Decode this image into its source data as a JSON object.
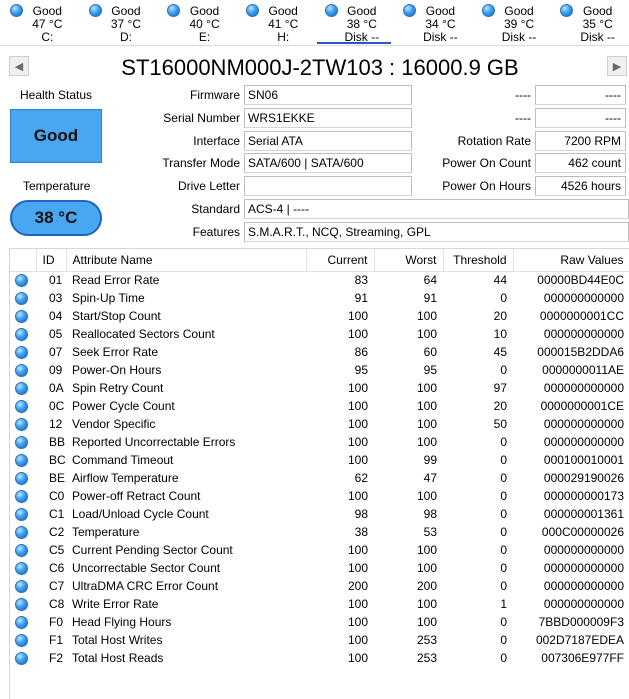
{
  "disks": [
    {
      "status": "Good",
      "temp": "47 °C",
      "label": "C:",
      "active": false
    },
    {
      "status": "Good",
      "temp": "37 °C",
      "label": "D:",
      "active": false
    },
    {
      "status": "Good",
      "temp": "40 °C",
      "label": "E:",
      "active": false
    },
    {
      "status": "Good",
      "temp": "41 °C",
      "label": "H:",
      "active": false
    },
    {
      "status": "Good",
      "temp": "38 °C",
      "label": "Disk --",
      "active": true
    },
    {
      "status": "Good",
      "temp": "34 °C",
      "label": "Disk --",
      "active": false
    },
    {
      "status": "Good",
      "temp": "39 °C",
      "label": "Disk --",
      "active": false
    },
    {
      "status": "Good",
      "temp": "35 °C",
      "label": "Disk --",
      "active": false
    }
  ],
  "nav": {
    "prev_icon": "◀",
    "next_icon": "▶"
  },
  "title": "ST16000NM000J-2TW103 : 16000.9 GB",
  "health": {
    "label": "Health Status",
    "value": "Good",
    "color": "#49a7f2"
  },
  "temperature": {
    "label": "Temperature",
    "value": "38 °C"
  },
  "fields": {
    "firmware": {
      "label": "Firmware",
      "value": "SN06"
    },
    "serial": {
      "label": "Serial Number",
      "value": "WRS1EKKE"
    },
    "interface": {
      "label": "Interface",
      "value": "Serial ATA"
    },
    "transfer_mode": {
      "label": "Transfer Mode",
      "value": "SATA/600 | SATA/600"
    },
    "drive_letter": {
      "label": "Drive Letter",
      "value": ""
    },
    "standard": {
      "label": "Standard",
      "value": "ACS-4 | ----"
    },
    "features": {
      "label": "Features",
      "value": "S.M.A.R.T., NCQ, Streaming, GPL"
    },
    "right1": {
      "label": "----",
      "value": "----"
    },
    "right2": {
      "label": "----",
      "value": "----"
    },
    "rotation_rate": {
      "label": "Rotation Rate",
      "value": "7200 RPM"
    },
    "power_on_count": {
      "label": "Power On Count",
      "value": "462 count"
    },
    "power_on_hours": {
      "label": "Power On Hours",
      "value": "4526 hours"
    }
  },
  "table": {
    "headers": [
      "ID",
      "Attribute Name",
      "Current",
      "Worst",
      "Threshold",
      "Raw Values"
    ],
    "rows": [
      [
        "01",
        "Read Error Rate",
        "83",
        "64",
        "44",
        "00000BD44E0C"
      ],
      [
        "03",
        "Spin-Up Time",
        "91",
        "91",
        "0",
        "000000000000"
      ],
      [
        "04",
        "Start/Stop Count",
        "100",
        "100",
        "20",
        "0000000001CC"
      ],
      [
        "05",
        "Reallocated Sectors Count",
        "100",
        "100",
        "10",
        "000000000000"
      ],
      [
        "07",
        "Seek Error Rate",
        "86",
        "60",
        "45",
        "000015B2DDA6"
      ],
      [
        "09",
        "Power-On Hours",
        "95",
        "95",
        "0",
        "0000000011AE"
      ],
      [
        "0A",
        "Spin Retry Count",
        "100",
        "100",
        "97",
        "000000000000"
      ],
      [
        "0C",
        "Power Cycle Count",
        "100",
        "100",
        "20",
        "0000000001CE"
      ],
      [
        "12",
        "Vendor Specific",
        "100",
        "100",
        "50",
        "000000000000"
      ],
      [
        "BB",
        "Reported Uncorrectable Errors",
        "100",
        "100",
        "0",
        "000000000000"
      ],
      [
        "BC",
        "Command Timeout",
        "100",
        "99",
        "0",
        "000100010001"
      ],
      [
        "BE",
        "Airflow Temperature",
        "62",
        "47",
        "0",
        "000029190026"
      ],
      [
        "C0",
        "Power-off Retract Count",
        "100",
        "100",
        "0",
        "000000000173"
      ],
      [
        "C1",
        "Load/Unload Cycle Count",
        "98",
        "98",
        "0",
        "000000001361"
      ],
      [
        "C2",
        "Temperature",
        "38",
        "53",
        "0",
        "000C00000026"
      ],
      [
        "C5",
        "Current Pending Sector Count",
        "100",
        "100",
        "0",
        "000000000000"
      ],
      [
        "C6",
        "Uncorrectable Sector Count",
        "100",
        "100",
        "0",
        "000000000000"
      ],
      [
        "C7",
        "UltraDMA CRC Error Count",
        "200",
        "200",
        "0",
        "000000000000"
      ],
      [
        "C8",
        "Write Error Rate",
        "100",
        "100",
        "1",
        "000000000000"
      ],
      [
        "F0",
        "Head Flying Hours",
        "100",
        "100",
        "0",
        "7BBD000009F3"
      ],
      [
        "F1",
        "Total Host Writes",
        "100",
        "253",
        "0",
        "002D7187EDEA"
      ],
      [
        "F2",
        "Total Host Reads",
        "100",
        "253",
        "0",
        "007306E977FF"
      ]
    ]
  }
}
